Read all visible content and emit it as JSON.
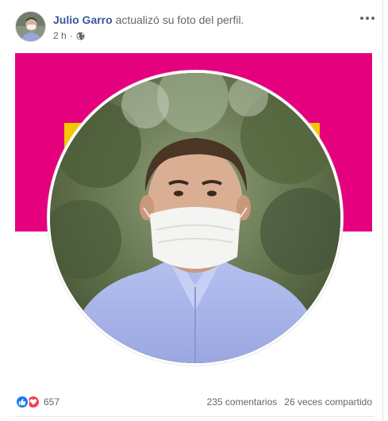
{
  "post": {
    "author": "Julio Garro",
    "action": " actualizó su foto del perfil.",
    "time": "2 h",
    "separator": "·",
    "privacy_icon": "globe-icon",
    "more_icon": "more-options-icon"
  },
  "photo": {
    "colors": {
      "background": "#e5007e",
      "accent": "#f5c700"
    }
  },
  "footer": {
    "reaction_icons": [
      "like-icon",
      "love-icon"
    ],
    "reaction_count": "657",
    "comments": "235 comentarios",
    "shares": "26 veces compartido"
  }
}
